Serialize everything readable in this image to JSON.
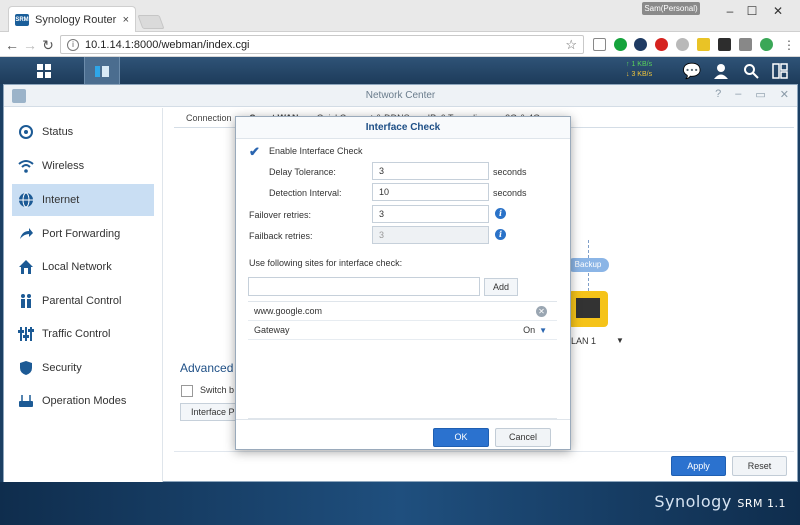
{
  "browser": {
    "tab_title": "Synology Router - Synolo",
    "tab_favicon_text": "SRM",
    "tab_close": "×",
    "profile": "Sam(Personal)",
    "url": "10.1.14.1:8000/webman/index.cgi"
  },
  "taskbar": {
    "upload_speed": "↑ 1 KB/s",
    "download_speed": "↓ 3 KB/s"
  },
  "window": {
    "title": "Network Center",
    "sidebar": [
      {
        "label": "Status",
        "icon": "status-icon",
        "selected": false
      },
      {
        "label": "Wireless",
        "icon": "wifi-icon",
        "selected": false
      },
      {
        "label": "Internet",
        "icon": "globe-icon",
        "selected": true
      },
      {
        "label": "Port Forwarding",
        "icon": "arrow-icon",
        "selected": false
      },
      {
        "label": "Local Network",
        "icon": "home-icon",
        "selected": false
      },
      {
        "label": "Parental Control",
        "icon": "family-icon",
        "selected": false
      },
      {
        "label": "Traffic Control",
        "icon": "sliders-icon",
        "selected": false
      },
      {
        "label": "Security",
        "icon": "shield-icon",
        "selected": false
      },
      {
        "label": "Operation Modes",
        "icon": "router-icon",
        "selected": false
      }
    ],
    "tabs": [
      {
        "label": "Connection",
        "active": false
      },
      {
        "label": "Smart WAN",
        "active": true
      },
      {
        "label": "QuickConnect & DDNS",
        "active": false
      },
      {
        "label": "IPv6 Tunneling",
        "active": false
      },
      {
        "label": "3G & 4G",
        "active": false
      }
    ],
    "backup_label": "Backup",
    "lan_label": "LAN 1",
    "advanced_heading": "Advanced S",
    "switch_label": "Switch b",
    "interface_button": "Interface P",
    "apply": "Apply",
    "reset": "Reset"
  },
  "dialog": {
    "title": "Interface Check",
    "enable_label": "Enable Interface Check",
    "delay_label": "Delay Tolerance:",
    "delay_value": "3",
    "delay_unit": "seconds",
    "interval_label": "Detection Interval:",
    "interval_value": "10",
    "interval_unit": "seconds",
    "failover_label": "Failover retries:",
    "failover_value": "3",
    "failback_label": "Failback retries:",
    "failback_value": "3",
    "sites_label": "Use following sites for interface check:",
    "site_input": "",
    "add": "Add",
    "sites": [
      {
        "name": "www.google.com",
        "value": ""
      },
      {
        "name": "Gateway",
        "value": "On"
      }
    ],
    "ok": "OK",
    "cancel": "Cancel"
  },
  "brand": {
    "name": "Synology",
    "product": "SRM 1.1"
  },
  "colors": {
    "accent": "#2b72cf",
    "selected": "#c9def3",
    "taskbar": "#1d3b5a"
  }
}
